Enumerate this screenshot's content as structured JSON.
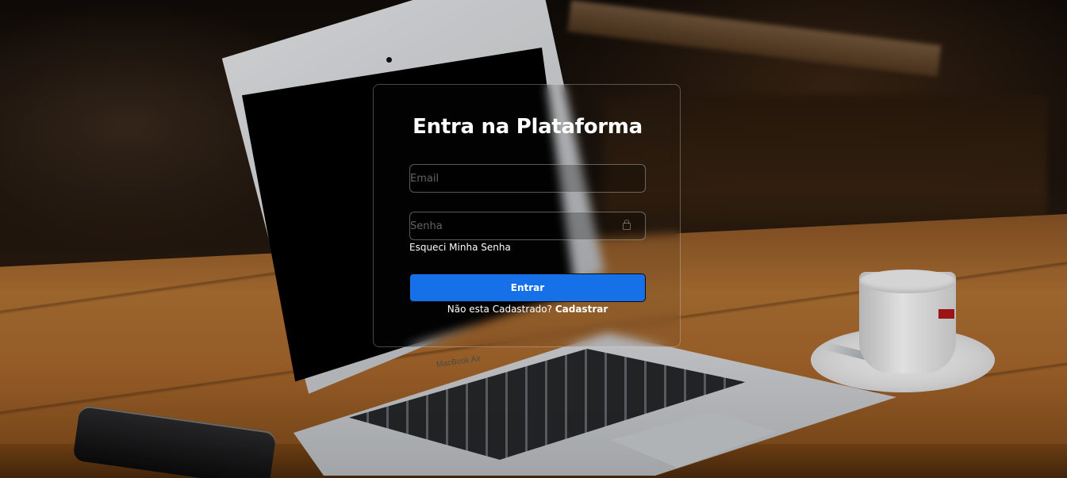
{
  "login_card": {
    "title": "Entra na Plataforma",
    "email_placeholder": "Email",
    "password_placeholder": "Senha",
    "forgot_password_label": "Esqueci Minha Senha",
    "submit_label": "Entrar",
    "signup_prompt": "Não esta Cadastrado?",
    "signup_link_label": "Cadastrar"
  },
  "background": {
    "laptop_label": "MacBook Air"
  },
  "colors": {
    "primary_button": "#1670e8",
    "text": "#ffffff"
  },
  "icons": {
    "password_field": "lock-icon"
  }
}
